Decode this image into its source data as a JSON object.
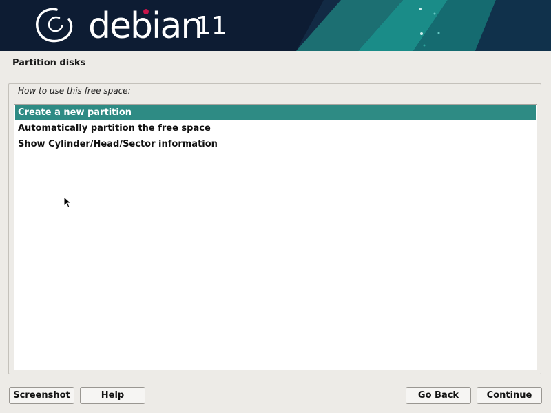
{
  "banner": {
    "logo_icon": "debian-swirl-icon",
    "brand": "debian",
    "version": "11",
    "colors": {
      "background": "#0d1c33",
      "accent_teal": "#1f8f8a",
      "logo_red": "#c7154a"
    }
  },
  "page": {
    "title": "Partition disks"
  },
  "question": {
    "prompt": "How to use this free space:",
    "options": [
      {
        "label": "Create a new partition",
        "selected": true
      },
      {
        "label": "Automatically partition the free space",
        "selected": false
      },
      {
        "label": "Show Cylinder/Head/Sector information",
        "selected": false
      }
    ]
  },
  "buttons": {
    "screenshot": "Screenshot",
    "help": "Help",
    "go_back": "Go Back",
    "continue": "Continue"
  },
  "colors": {
    "selection": "#2e8b84",
    "window_bg": "#edebe7"
  }
}
